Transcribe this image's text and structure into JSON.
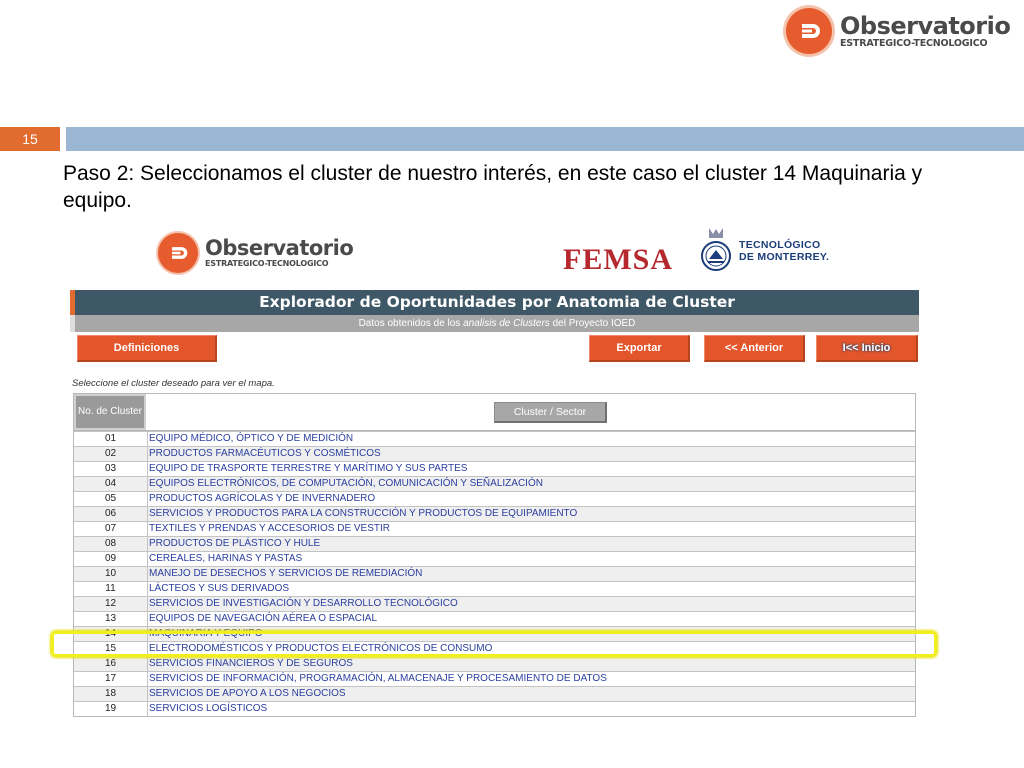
{
  "header_logo": {
    "main": "Observatorio",
    "sub": "ESTRATEGICO-TECNOLOGICO"
  },
  "slide": {
    "number": "15",
    "text": "Paso 2: Seleccionamos el cluster de nuestro interés, en este caso el cluster 14 Maquinaria y equipo."
  },
  "inner_logo": {
    "main": "Observatorio",
    "sub": "ESTRATEGICO-TECNOLOGICO"
  },
  "femsa_logo": "FEMSA",
  "tec_logo": {
    "line1": "TECNOLÓGICO",
    "line2": "DE MONTERREY."
  },
  "app": {
    "title": "Explorador de Oportunidades por Anatomia de Cluster",
    "subtitle_pre": "Datos obtenidos de los",
    "subtitle_em": "analisis de Clusters",
    "subtitle_post": "del Proyecto IOED"
  },
  "buttons": {
    "definiciones": "Definiciones",
    "exportar": "Exportar",
    "anterior": "<< Anterior",
    "inicio": "I<< Inicio"
  },
  "prompt": "Seleccione el cluster deseado para ver el mapa.",
  "table": {
    "header_no": "No. de Cluster",
    "header_cluster": "Cluster / Sector",
    "rows": [
      {
        "no": "01",
        "name": "EQUIPO MÉDICO, ÓPTICO Y DE MEDICIÓN"
      },
      {
        "no": "02",
        "name": "PRODUCTOS FARMACÉUTICOS Y COSMÉTICOS"
      },
      {
        "no": "03",
        "name": "EQUIPO DE TRASPORTE TERRESTRE Y MARÍTIMO Y SUS PARTES"
      },
      {
        "no": "04",
        "name": "EQUIPOS ELECTRÓNICOS, DE COMPUTACIÓN, COMUNICACIÓN Y SEÑALIZACIÓN"
      },
      {
        "no": "05",
        "name": "PRODUCTOS AGRÍCOLAS Y DE INVERNADERO"
      },
      {
        "no": "06",
        "name": "SERVICIOS Y PRODUCTOS PARA LA CONSTRUCCIÓN Y PRODUCTOS DE EQUIPAMIENTO"
      },
      {
        "no": "07",
        "name": "TEXTILES Y PRENDAS Y ACCESORIOS DE VESTIR"
      },
      {
        "no": "08",
        "name": "PRODUCTOS DE PLÁSTICO Y HULE"
      },
      {
        "no": "09",
        "name": "CEREALES, HARINAS Y PASTAS"
      },
      {
        "no": "10",
        "name": "MANEJO DE DESECHOS Y SERVICIOS DE REMEDIACIÓN"
      },
      {
        "no": "11",
        "name": "LÁCTEOS Y SUS DERIVADOS"
      },
      {
        "no": "12",
        "name": "SERVICIOS DE INVESTIGACIÓN Y DESARROLLO TECNOLÓGICO"
      },
      {
        "no": "13",
        "name": "EQUIPOS DE NAVEGACIÓN AÉREA O ESPACIAL"
      },
      {
        "no": "14",
        "name": "MAQUINARIA Y EQUIPO"
      },
      {
        "no": "15",
        "name": "ELECTRODOMÉSTICOS Y PRODUCTOS ELECTRÓNICOS DE CONSUMO"
      },
      {
        "no": "16",
        "name": "SERVICIOS FINANCIEROS Y DE SEGUROS"
      },
      {
        "no": "17",
        "name": "SERVICIOS DE INFORMACIÓN, PROGRAMACIÓN, ALMACENAJE Y PROCESAMIENTO DE DATOS"
      },
      {
        "no": "18",
        "name": "SERVICIOS DE APOYO A LOS NEGOCIOS"
      },
      {
        "no": "19",
        "name": "SERVICIOS LOGÍSTICOS"
      }
    ]
  },
  "highlighted_row": "14",
  "colors": {
    "accent": "#e26b2f",
    "header_bg": "#3f5867",
    "bar": "#9ab6d2",
    "highlight": "#f2ef1f"
  }
}
